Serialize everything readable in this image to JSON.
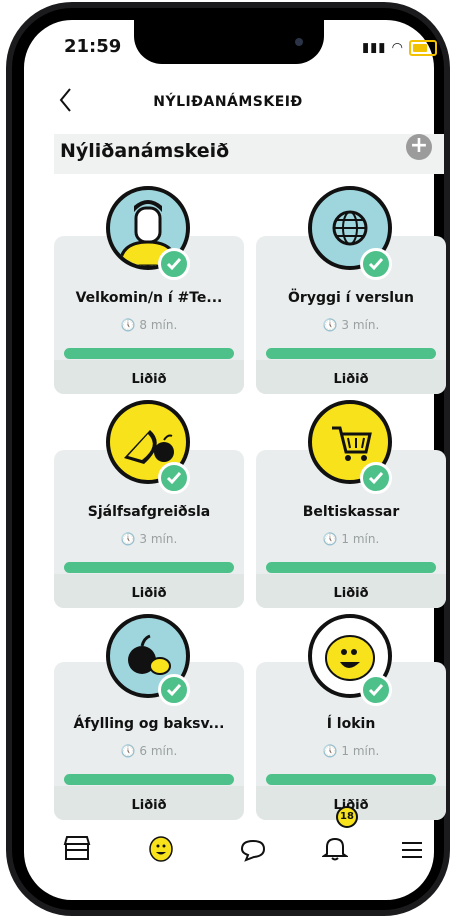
{
  "status": {
    "time": "21:59"
  },
  "header": {
    "title": "NÝLIÐANÁMSKEIÐ"
  },
  "section": {
    "title": "Nýliðanámskeið",
    "add_icon": "plus-icon"
  },
  "cards": [
    {
      "title": "Velkomin/n í #Te...",
      "duration": "8 mín.",
      "status": "Liðið",
      "icon": "person-avatar-icon",
      "progress": 1.0
    },
    {
      "title": "Öryggi í verslun",
      "duration": "3 mín.",
      "status": "Liðið",
      "icon": "globe-icon",
      "progress": 1.0
    },
    {
      "title": "Sjálfsafgreiðsla",
      "duration": "3 mín.",
      "status": "Liðið",
      "icon": "lemon-apple-icon",
      "progress": 1.0
    },
    {
      "title": "Beltiskassar",
      "duration": "1 mín.",
      "status": "Liðið",
      "icon": "shopping-cart-icon",
      "progress": 1.0
    },
    {
      "title": "Áfylling og baksv...",
      "duration": "6 mín.",
      "status": "Liðið",
      "icon": "fruit-icon",
      "progress": 1.0
    },
    {
      "title": "Í lokin",
      "duration": "1 mín.",
      "status": "Liðið",
      "icon": "smiley-lemon-icon",
      "progress": 1.0
    }
  ],
  "nav": {
    "items": [
      "store-icon",
      "lemon-icon",
      "chat-icon",
      "bell-icon",
      "menu-icon"
    ],
    "notifications_count": "18"
  },
  "colors": {
    "accent_green": "#4dc189",
    "yellow": "#f7e21b",
    "card_bg": "#e9eded"
  }
}
